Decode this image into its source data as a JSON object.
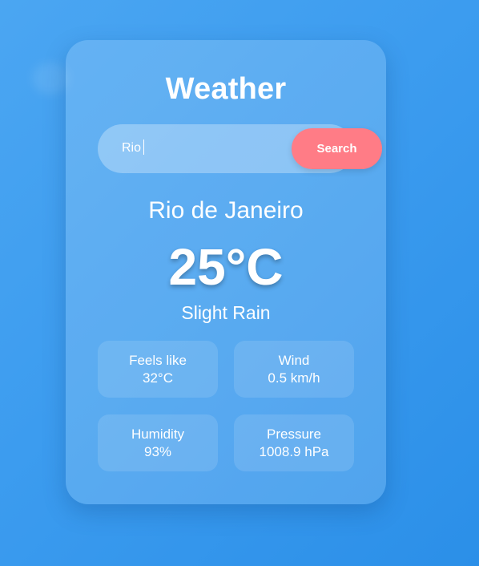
{
  "app": {
    "title": "Weather"
  },
  "search": {
    "value": "Rio",
    "button_label": "Search"
  },
  "current": {
    "city": "Rio de Janeiro",
    "temperature": "25°C",
    "condition": "Slight Rain"
  },
  "details": [
    {
      "label": "Feels like",
      "value": "32°C"
    },
    {
      "label": "Wind",
      "value": "0.5 km/h"
    },
    {
      "label": "Humidity",
      "value": "93%"
    },
    {
      "label": "Pressure",
      "value": "1008.9 hPa"
    }
  ],
  "colors": {
    "background": "#3c9cef",
    "search_button": "#ff7c86",
    "text": "#ffffff"
  }
}
